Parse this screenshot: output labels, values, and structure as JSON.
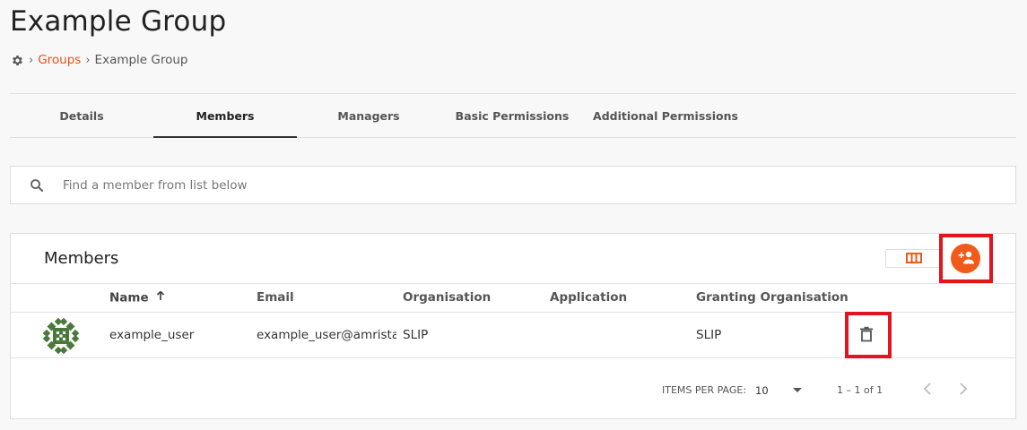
{
  "page": {
    "title": "Example Group"
  },
  "breadcrumb": {
    "icon": "settings-icon",
    "parent": "Groups",
    "current": "Example Group"
  },
  "tabs": [
    {
      "label": "Details",
      "active": false
    },
    {
      "label": "Members",
      "active": true
    },
    {
      "label": "Managers",
      "active": false
    },
    {
      "label": "Basic Permissions",
      "active": false
    },
    {
      "label": "Additional Permissions",
      "active": false
    }
  ],
  "search": {
    "placeholder": "Find a member from list below",
    "value": ""
  },
  "members": {
    "title": "Members",
    "columns": {
      "name": "Name",
      "email": "Email",
      "organisation": "Organisation",
      "application": "Application",
      "granting": "Granting Organisation"
    },
    "rows": [
      {
        "name": "example_user",
        "email": "example_user@amristar",
        "organisation": "SLIP",
        "application": "",
        "granting": "SLIP"
      }
    ]
  },
  "paginator": {
    "items_per_page_label": "ITEMS PER PAGE:",
    "page_size": "10",
    "range": "1 – 1 of 1"
  },
  "colors": {
    "accent": "#f05a1a",
    "highlight": "#e2141f",
    "avatar": "#4a7a3a"
  }
}
